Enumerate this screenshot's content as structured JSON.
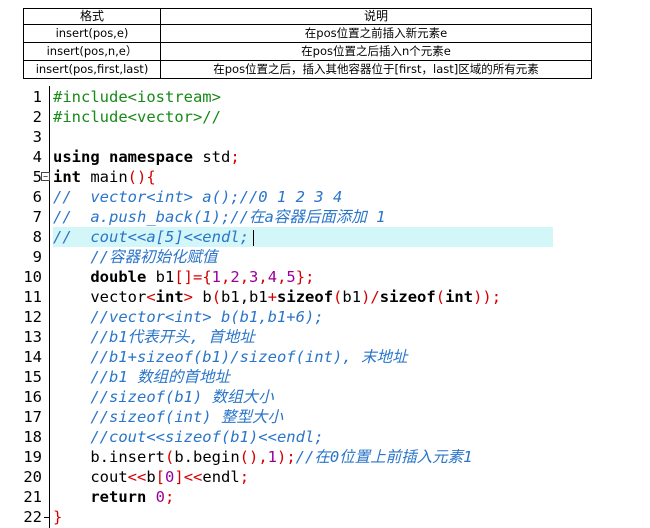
{
  "table": {
    "headers": [
      "格式",
      "说明"
    ],
    "rows": [
      [
        "insert(pos,e)",
        "在pos位置之前插入新元素e"
      ],
      [
        "insert(pos,n,e）",
        "在pos位置之后插入n个元素e"
      ],
      [
        "insert(pos,first,last)",
        "在pos位置之后，插入其他容器位于[first，last]区域的所有元素"
      ]
    ]
  },
  "code_lines": [
    {
      "n": "1",
      "tokens": [
        [
          "pp",
          "#include<iostream>"
        ]
      ]
    },
    {
      "n": "2",
      "tokens": [
        [
          "pp",
          "#include<vector>//"
        ]
      ]
    },
    {
      "n": "3",
      "tokens": []
    },
    {
      "n": "4",
      "tokens": [
        [
          "kw",
          "using namespace "
        ],
        [
          "tx",
          "std"
        ],
        [
          "op",
          ";"
        ]
      ]
    },
    {
      "n": "5",
      "fold": "⊟",
      "tokens": [
        [
          "kw",
          "int "
        ],
        [
          "tx",
          "main"
        ],
        [
          "op",
          "(){"
        ]
      ]
    },
    {
      "n": "6",
      "tokens": [
        [
          "cm",
          "//  vector<int> a();//0 1 2 3 4"
        ]
      ]
    },
    {
      "n": "7",
      "tokens": [
        [
          "cm",
          "//  a.push_back(1);//在a容器后面添加 1"
        ]
      ]
    },
    {
      "n": "8",
      "highlight": true,
      "tokens": [
        [
          "cm",
          "//  cout<<a[5]<<endl;"
        ]
      ]
    },
    {
      "n": "9",
      "tokens": [
        [
          "tx",
          "    "
        ],
        [
          "cm",
          "//容器初始化赋值"
        ]
      ]
    },
    {
      "n": "10",
      "tokens": [
        [
          "tx",
          "    "
        ],
        [
          "kw",
          "double "
        ],
        [
          "tx",
          "b1"
        ],
        [
          "op",
          "[]={"
        ],
        [
          "num",
          "1"
        ],
        [
          "op",
          ","
        ],
        [
          "num",
          "2"
        ],
        [
          "op",
          ","
        ],
        [
          "num",
          "3"
        ],
        [
          "op",
          ","
        ],
        [
          "num",
          "4"
        ],
        [
          "op",
          ","
        ],
        [
          "num",
          "5"
        ],
        [
          "op",
          "};"
        ]
      ]
    },
    {
      "n": "11",
      "tokens": [
        [
          "tx",
          "    vector"
        ],
        [
          "op",
          "<"
        ],
        [
          "kw",
          "int"
        ],
        [
          "op",
          "> "
        ],
        [
          "tx",
          "b"
        ],
        [
          "op",
          "("
        ],
        [
          "tx",
          "b1,b1"
        ],
        [
          "op",
          "+"
        ],
        [
          "kw",
          "sizeof"
        ],
        [
          "op",
          "("
        ],
        [
          "tx",
          "b1"
        ],
        [
          "op",
          ")/"
        ],
        [
          "kw",
          "sizeof"
        ],
        [
          "op",
          "("
        ],
        [
          "kw",
          "int"
        ],
        [
          "op",
          "));"
        ]
      ]
    },
    {
      "n": "12",
      "tokens": [
        [
          "tx",
          "    "
        ],
        [
          "cm",
          "//vector<int> b(b1,b1+6);"
        ]
      ]
    },
    {
      "n": "13",
      "tokens": [
        [
          "tx",
          "    "
        ],
        [
          "cm",
          "//b1代表开头, 首地址"
        ]
      ]
    },
    {
      "n": "14",
      "tokens": [
        [
          "tx",
          "    "
        ],
        [
          "cm",
          "//b1+sizeof(b1)/sizeof(int), 末地址"
        ]
      ]
    },
    {
      "n": "15",
      "tokens": [
        [
          "tx",
          "    "
        ],
        [
          "cm",
          "//b1 数组的首地址"
        ]
      ]
    },
    {
      "n": "16",
      "tokens": [
        [
          "tx",
          "    "
        ],
        [
          "cm",
          "//sizeof(b1) 数组大小"
        ]
      ]
    },
    {
      "n": "17",
      "tokens": [
        [
          "tx",
          "    "
        ],
        [
          "cm",
          "//sizeof(int) 整型大小"
        ]
      ]
    },
    {
      "n": "18",
      "tokens": [
        [
          "tx",
          "    "
        ],
        [
          "cm",
          "//cout<<sizeof(b1)<<endl;"
        ]
      ]
    },
    {
      "n": "19",
      "tokens": [
        [
          "tx",
          "    b.insert"
        ],
        [
          "op",
          "("
        ],
        [
          "tx",
          "b.begin"
        ],
        [
          "op",
          "(),"
        ],
        [
          "num",
          "1"
        ],
        [
          "op",
          ");"
        ],
        [
          "cm",
          "//在0位置上前插入元素1"
        ]
      ]
    },
    {
      "n": "20",
      "tokens": [
        [
          "tx",
          "    cout"
        ],
        [
          "op",
          "<<"
        ],
        [
          "tx",
          "b"
        ],
        [
          "op",
          "["
        ],
        [
          "num",
          "0"
        ],
        [
          "op",
          "]<<"
        ],
        [
          "tx",
          "endl"
        ],
        [
          "op",
          ";"
        ]
      ]
    },
    {
      "n": "21",
      "tokens": [
        [
          "tx",
          "    "
        ],
        [
          "kw",
          "return "
        ],
        [
          "num",
          "0"
        ],
        [
          "op",
          ";"
        ]
      ]
    },
    {
      "n": "22",
      "tokens": [
        [
          "op",
          "}"
        ]
      ]
    }
  ]
}
